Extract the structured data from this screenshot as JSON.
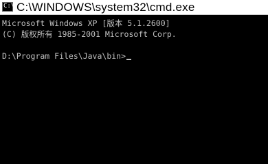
{
  "window": {
    "title": "C:\\WINDOWS\\system32\\cmd.exe",
    "icon": "cmd-prompt-icon",
    "icon_glyph": "C:\\"
  },
  "console": {
    "lines": [
      "Microsoft Windows XP [版本 5.1.2600]",
      "(C) 版权所有 1985-2001 Microsoft Corp.",
      "D:\\Program Files\\Java\\bin>"
    ],
    "text_color": "#c0c0c0",
    "background": "#000000"
  }
}
